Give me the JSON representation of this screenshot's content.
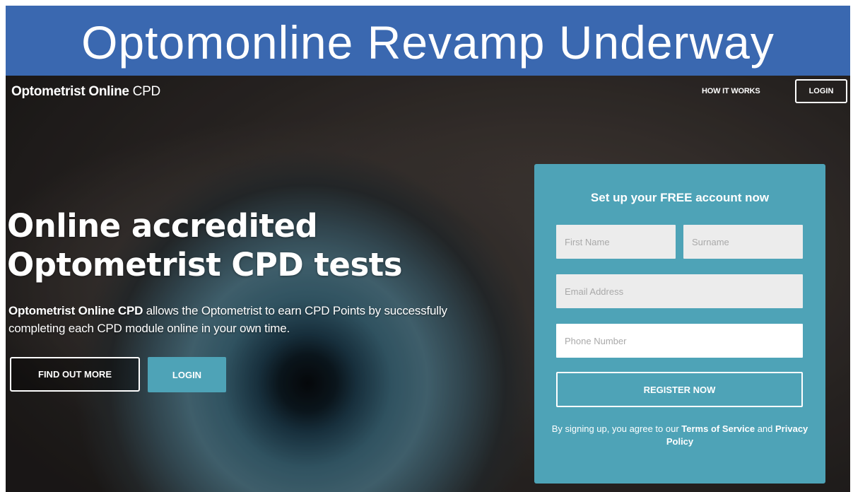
{
  "banner": {
    "title": "Optomonline Revamp Underway"
  },
  "header": {
    "logo_bold": "Optometrist Online",
    "logo_light": " CPD",
    "nav_how": "HOW IT WORKS",
    "nav_login": "LOGIN"
  },
  "hero": {
    "headline_line1": "Online accredited",
    "headline_line2": "Optometrist CPD tests",
    "desc_bold": "Optometrist Online CPD",
    "desc_rest": " allows the Optometrist to earn CPD Points by successfully completing each CPD module online in your own time.",
    "btn_findout": "FIND OUT MORE",
    "btn_login": "LOGIN"
  },
  "signup": {
    "title": "Set up your FREE account now",
    "first_name_placeholder": "First Name",
    "surname_placeholder": "Surname",
    "email_placeholder": "Email Address",
    "phone_placeholder": "Phone Number",
    "register_label": "REGISTER NOW",
    "terms_prefix": "By signing up, you agree to our ",
    "terms_link": "Terms of Service",
    "terms_and": " and ",
    "privacy_link": "Privacy Policy"
  },
  "colors": {
    "banner_bg": "#3a68b0",
    "accent_teal": "#4ea3b7",
    "text_white": "#ffffff"
  }
}
